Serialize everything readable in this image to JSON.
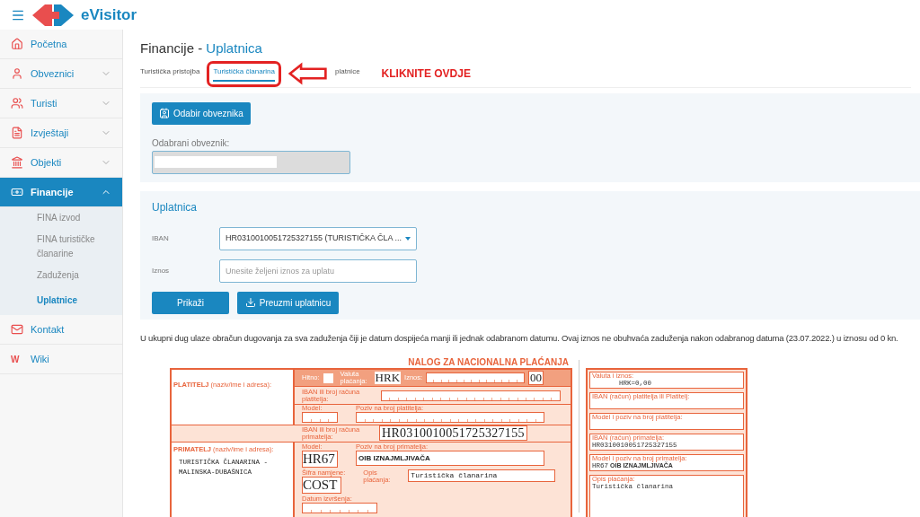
{
  "header": {
    "brand": "eVisitor"
  },
  "sidebar": {
    "items": [
      {
        "label": "Početna",
        "selected": false
      },
      {
        "label": "Obveznici",
        "selected": false,
        "expanded": false
      },
      {
        "label": "Turisti",
        "selected": false,
        "expanded": false
      },
      {
        "label": "Izvještaji",
        "selected": false,
        "expanded": false
      },
      {
        "label": "Objekti",
        "selected": false,
        "expanded": false
      },
      {
        "label": "Financije",
        "selected": true,
        "expanded": true,
        "children": [
          {
            "label": "FINA izvod",
            "selected": false
          },
          {
            "label": "FINA turističke članarine",
            "selected": false
          },
          {
            "label": "Zaduženja",
            "selected": false
          },
          {
            "label": "Uplatnice",
            "selected": true
          }
        ]
      },
      {
        "label": "Kontakt",
        "selected": false
      },
      {
        "label": "Wiki",
        "selected": false,
        "icon_text": "W"
      }
    ]
  },
  "page": {
    "title": "Financije - ",
    "title_highlight": "Uplatnica"
  },
  "tabs": [
    {
      "label": "Turistička pristojba",
      "selected": false
    },
    {
      "label": "Turistička članarina",
      "selected": true
    },
    {
      "label": "platnice",
      "selected": false
    }
  ],
  "annotation": {
    "text": "KLIKNITE OVDJE"
  },
  "taxpayer": {
    "button": "Odabir obveznika",
    "label": "Odabrani obveznik:"
  },
  "payment": {
    "title": "Uplatnica",
    "iban_label": "IBAN",
    "iban_value": "HR0310010051725327155 (TURISTIČKA ČLA ...",
    "amount_label": "Iznos",
    "amount_placeholder": "Unesite željeni iznos za uplatu",
    "buttons": [
      "Prikaži",
      "Preuzmi uplatnicu"
    ]
  },
  "note": "U ukupni dug ulaze obračun dugovanja za sva zaduženja čiji je datum dospijeća manji ili jednak odabranom datumu. Ovaj iznos ne obuhvaća zaduženja nakon odabranog datuma (23.07.2022.) u iznosu od 0 kn.",
  "slip": {
    "title": "NALOG ZA NACIONALNA PLAĆANJA",
    "payer_label": "**PLATITELJ** (naziv/ime i adresa):",
    "urgent_label": "Hitno:",
    "urgent": false,
    "currency_label": "Valuta plaćanja:",
    "currency": "HRK",
    "amount_label": "Iznos:",
    "amount": "00",
    "payer_iban_label": "IBAN ili broj računa platitelja:",
    "payer_model_label": "Model:",
    "payer_reference_label": "Poziv na broj platitelja:",
    "payee_iban_label": "IBAN ili broj računa primatelja:",
    "payee_iban": "HR0310010051725327155",
    "payee_label": "**PRIMATELJ** (naziv/ime i adresa):",
    "payee_name": "TURISTIČKA ČLANARINA -",
    "payee_place": "MALINSKA-DUBAŠNICA",
    "payee_model_label": "Model:",
    "payee_model": "HR67",
    "payee_reference_label": "Poziv na broj primatelja:",
    "payee_reference": "OIB IZNAJMLJIVAČA",
    "purpose_code_label": "Šifra namjene:",
    "purpose_code": "COST",
    "description_label": "Opis plaćanja:",
    "description": "Turistička članarina",
    "date_label": "Datum izvršenja:"
  },
  "receipt": {
    "amount_label": "Valuta i iznos:",
    "amount": "HRK=0,00",
    "payer_label": "IBAN (račun) platitelja ili Platitelj:",
    "payer_model_label": "Model i poziv na broj platitelja:",
    "payee_iban_label": "IBAN (račun) primatelja:",
    "payee_iban": "HR0310010051725327155",
    "payee_model_label": "Model i poziv na broj primatelja:",
    "payee_model": "HR67",
    "payee_reference": "OIB IZNAJMLJIVAČA",
    "description_label": "Opis plaćanja:",
    "description": "Turistička članarina"
  }
}
